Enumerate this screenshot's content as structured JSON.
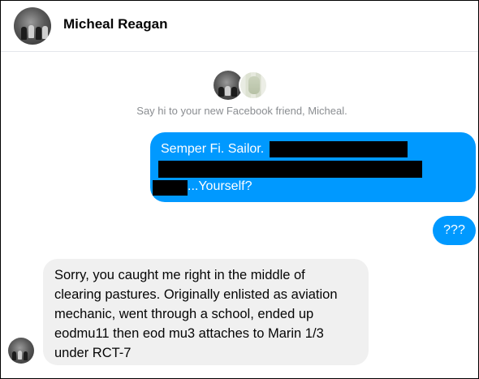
{
  "header": {
    "title": "Micheal Reagan"
  },
  "intro": {
    "text": "Say hi to your new Facebook friend, Micheal."
  },
  "sent_message": {
    "line1": "Semper Fi. Sailor.",
    "line3_suffix": "...Yourself?"
  },
  "sent_short": {
    "text": "???"
  },
  "received_message": {
    "lines": [
      "Sorry, you caught me right in the middle of",
      "clearing pastures. Originally enlisted as aviation",
      "mechanic, went through a school, ended up",
      "eodmu11 then eod mu3 attaches to Marin 1/3",
      "under RCT-7"
    ]
  },
  "colors": {
    "sent_bubble": "#0099ff",
    "received_bubble": "#f0f0f0",
    "meta_text": "#8a8d91"
  }
}
